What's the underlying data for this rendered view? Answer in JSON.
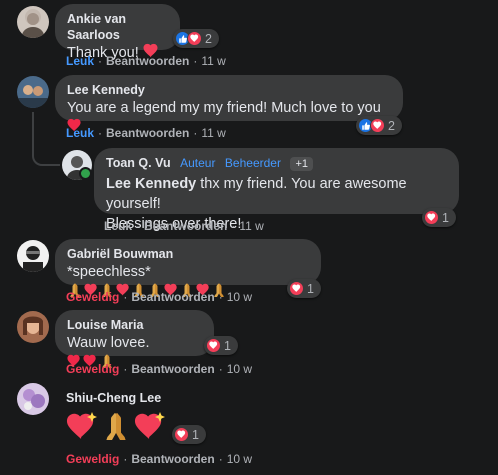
{
  "colors": {
    "background": "#18191a",
    "bubble": "#3a3b3c",
    "like_blue": "#4599ff",
    "love_red": "#f33e58",
    "muted": "#b0b3b8"
  },
  "comments": [
    {
      "author": "Ankie van Saarloos",
      "text": "Thank you!",
      "emoji": "sparkling-heart",
      "reaction_icons": [
        "like",
        "love"
      ],
      "reaction_count": "2",
      "action": "Leuk",
      "reply": "Beantwoorden",
      "time": "11 w"
    },
    {
      "author": "Lee Kennedy",
      "text": "You are a legend my my friend! Much love to you",
      "emoji": "red-heart",
      "reaction_icons": [
        "like",
        "love"
      ],
      "reaction_count": "2",
      "action": "Leuk",
      "reply": "Beantwoorden",
      "time": "11 w",
      "reply_comment": {
        "author": "Toan Q. Vu",
        "tag_author": "Auteur",
        "tag_admin": "Beheerder",
        "tag_more": "+1",
        "mention": "Lee Kennedy",
        "text_line1": " thx my friend. You are awesome yourself!",
        "text_line2": "Blessings over there!",
        "reaction_icons": [
          "love"
        ],
        "reaction_count": "1",
        "action": "Leuk",
        "reply": "Beantwoorden",
        "time": "11 w"
      }
    },
    {
      "author": "Gabriël Bouwman",
      "text": "*speechless*",
      "emoji": "folded-hands-and-hearts",
      "reaction_icons": [
        "love"
      ],
      "reaction_count": "1",
      "action": "Geweldig",
      "reply": "Beantwoorden",
      "time": "10 w"
    },
    {
      "author": "Louise Maria",
      "text": "Wauw lovee.",
      "emoji": "hearts-and-folded-hands",
      "reaction_icons": [
        "love"
      ],
      "reaction_count": "1",
      "action": "Geweldig",
      "reply": "Beantwoorden",
      "time": "10 w"
    },
    {
      "author": "Shiu-Cheng Lee",
      "text": "",
      "emoji": "sparkling-heart-folded-hands-sparkling-heart",
      "reaction_icons": [
        "love"
      ],
      "reaction_count": "1",
      "action": "Geweldig",
      "reply": "Beantwoorden",
      "time": "10 w"
    }
  ]
}
